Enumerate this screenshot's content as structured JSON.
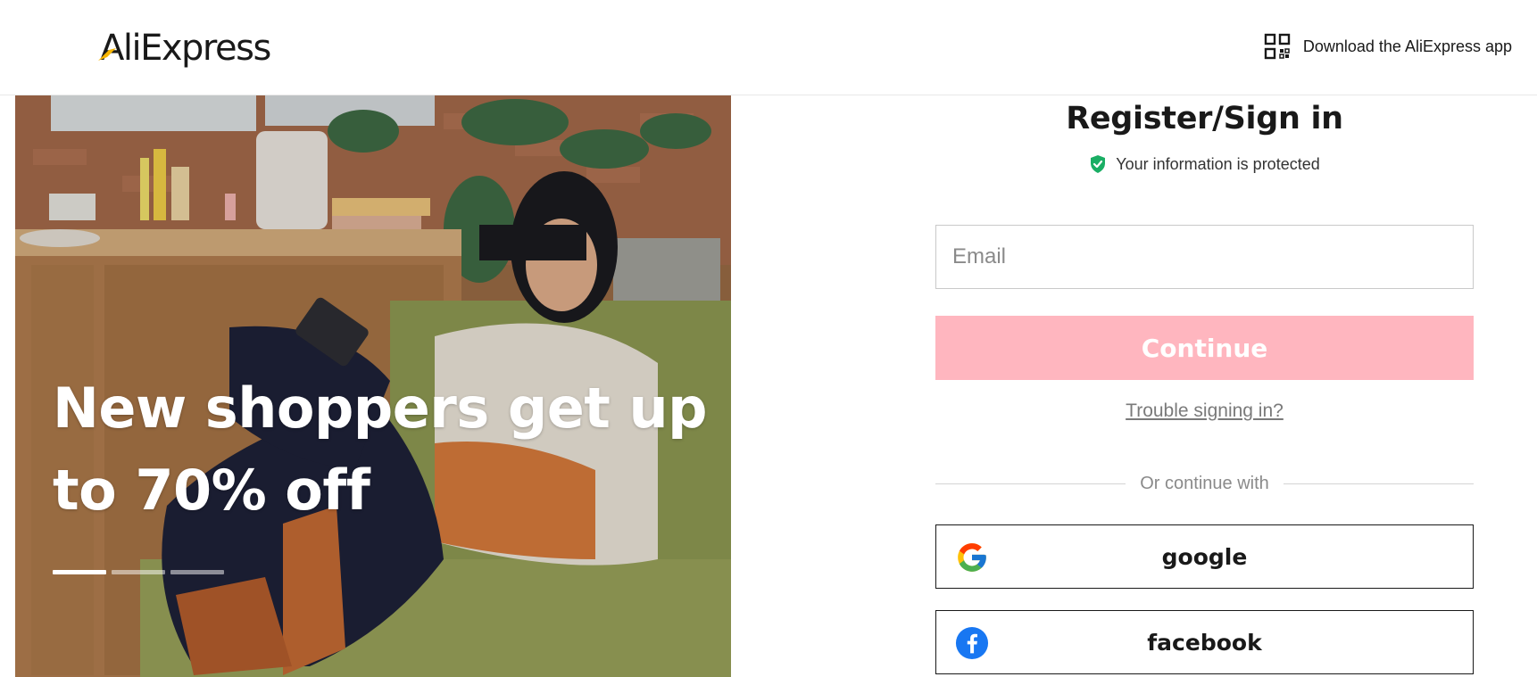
{
  "header": {
    "logo_text": "AliExpress",
    "download_label": "Download the AliExpress app"
  },
  "hero": {
    "headline_line1": "New shoppers get up",
    "headline_line2": "to 70% off",
    "carousel": {
      "slide_count": 3,
      "active_index": 0
    }
  },
  "signin": {
    "title": "Register/Sign in",
    "protected_text": "Your information is protected",
    "email_placeholder": "Email",
    "continue_label": "Continue",
    "trouble_link": "Trouble signing in?",
    "divider_text": "Or continue with",
    "social": [
      {
        "label": "google",
        "icon": "google-icon"
      },
      {
        "label": "facebook",
        "icon": "facebook-icon"
      }
    ]
  },
  "colors": {
    "continue_button": "#ffb6bf",
    "shield": "#1aae64",
    "facebook_blue": "#1877f2",
    "logo_accent": "#f7b500"
  }
}
